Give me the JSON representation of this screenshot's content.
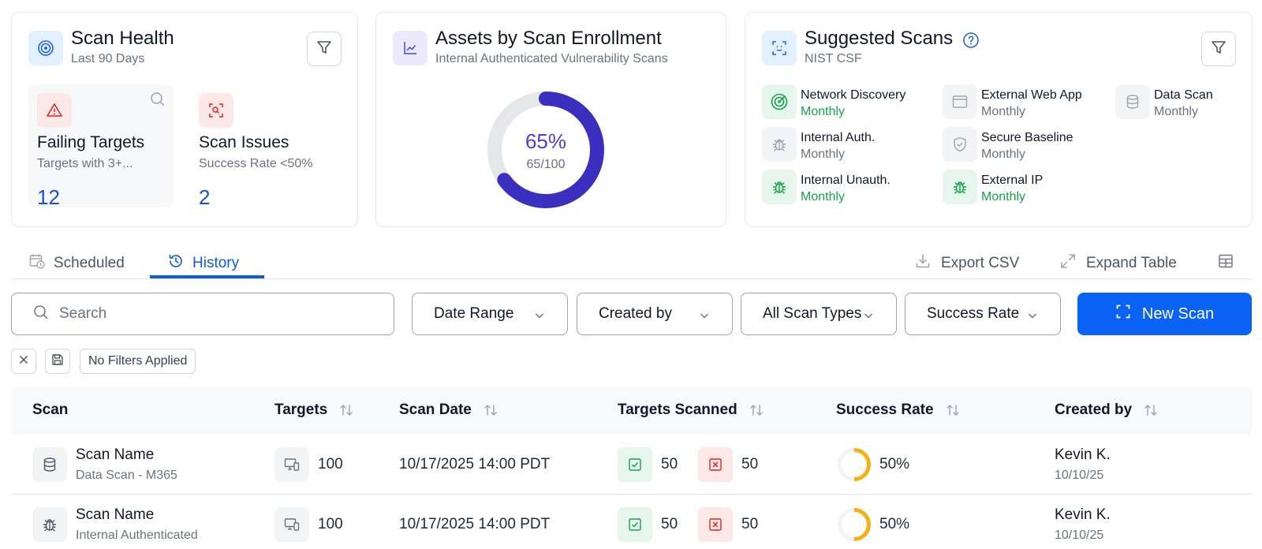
{
  "scan_health": {
    "title": "Scan Health",
    "subtitle": "Last 90 Days",
    "failing": {
      "title": "Failing Targets",
      "desc": "Targets with 3+...",
      "value": "12"
    },
    "issues": {
      "title": "Scan Issues",
      "desc": "Success Rate <50%",
      "value": "2"
    }
  },
  "enrollment": {
    "title": "Assets by Scan Enrollment",
    "subtitle": "Internal Authenticated Vulnerability Scans",
    "percent_label": "65%",
    "count_label": "65/100",
    "fraction": 0.65,
    "ring_color": "#3b2fc0",
    "track_color": "#e5e7eb"
  },
  "suggested": {
    "title": "Suggested Scans",
    "subtitle": "NIST CSF",
    "items": [
      {
        "name": "Network Discovery",
        "freq": "Monthly",
        "icon": "radar-icon"
      },
      {
        "name": "External Web App",
        "freq": "Monthly",
        "icon": "browser-window-icon"
      },
      {
        "name": "Data Scan",
        "freq": "Monthly",
        "icon": "database-icon"
      },
      {
        "name": "Internal Auth.",
        "freq": "Monthly",
        "icon": "bug-icon"
      },
      {
        "name": "Secure Baseline",
        "freq": "Monthly",
        "icon": "shield-icon"
      },
      {
        "name": "Internal Unauth.",
        "freq": "Monthly",
        "icon": "bug-icon"
      },
      {
        "name": "External IP",
        "freq": "Monthly",
        "icon": "bug-icon"
      }
    ]
  },
  "tabs": {
    "scheduled": "Scheduled",
    "history": "History",
    "active": "history"
  },
  "toolbar": {
    "export": "Export CSV",
    "expand": "Expand Table"
  },
  "filters": {
    "search_placeholder": "Search",
    "date_range": "Date Range",
    "created_by": "Created by",
    "scan_types": "All Scan Types",
    "success_rate": "Success Rate",
    "new_scan": "New Scan",
    "no_filters": "No Filters Applied"
  },
  "table": {
    "headers": [
      "Scan",
      "Targets",
      "Scan Date",
      "Targets Scanned",
      "Success Rate",
      "Created by"
    ],
    "rows": [
      {
        "name": "Scan Name",
        "type": "Data Scan - M365",
        "icon": "database-icon",
        "targets": "100",
        "date": "10/17/2025 14:00 PDT",
        "passed": "50",
        "failed": "50",
        "success_label": "50%",
        "success_fraction": 0.5,
        "creator": "Kevin K.",
        "created_date": "10/10/25"
      },
      {
        "name": "Scan Name",
        "type": "Internal Authenticated",
        "icon": "bug-icon",
        "targets": "100",
        "date": "10/17/2025 14:00 PDT",
        "passed": "50",
        "failed": "50",
        "success_label": "50%",
        "success_fraction": 0.5,
        "creator": "Kevin K.",
        "created_date": "10/10/25"
      }
    ]
  },
  "colors": {
    "accent_blue": "#0b63f6",
    "success_green": "#16a34a",
    "danger_red": "#dc2626",
    "warning_amber": "#f5b012"
  }
}
